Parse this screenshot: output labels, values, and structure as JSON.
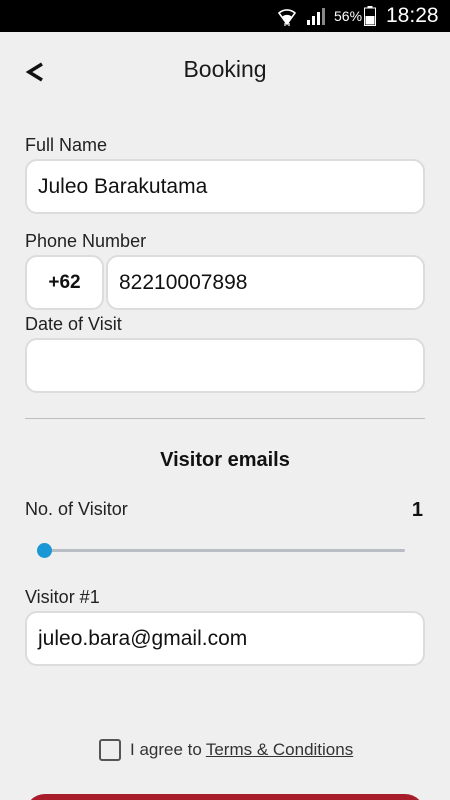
{
  "status_bar": {
    "battery_percent": "56%",
    "time": "18:28",
    "icons": [
      "wifi-icon",
      "signal-icon",
      "battery-icon"
    ]
  },
  "header": {
    "title": "Booking",
    "back_label": "<"
  },
  "form": {
    "full_name": {
      "label": "Full Name",
      "value": "Juleo Barakutama"
    },
    "phone": {
      "label": "Phone Number",
      "country_code": "+62",
      "value": "82210007898"
    },
    "date_of_visit": {
      "label": "Date of Visit",
      "value": ""
    },
    "visitor_section_title": "Visitor emails",
    "visitor_count": {
      "label": "No. of Visitor",
      "value": "1",
      "slider_fraction": 0.0
    },
    "visitors": [
      {
        "label": "Visitor #1",
        "email": "juleo.bara@gmail.com"
      }
    ],
    "agree": {
      "text": "I agree to",
      "link": "Terms & Conditions",
      "checked": false
    }
  },
  "colors": {
    "accent": "#1a98d5",
    "submit": "#a81d2a",
    "background": "#efefef"
  }
}
